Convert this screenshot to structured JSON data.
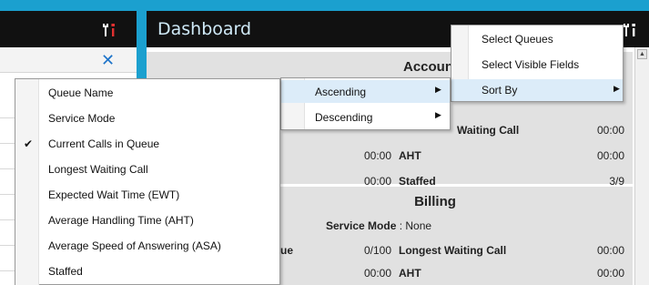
{
  "dashboard": {
    "title": "Dashboard"
  },
  "context_menu": {
    "items": [
      {
        "label": "Select Queues"
      },
      {
        "label": "Select Visible Fields"
      },
      {
        "label": "Sort By"
      }
    ]
  },
  "sort_menu": {
    "items": [
      {
        "label": "Ascending"
      },
      {
        "label": "Descending"
      }
    ]
  },
  "fields_menu": {
    "items": [
      {
        "label": "Queue Name",
        "checked": false
      },
      {
        "label": "Service Mode",
        "checked": false
      },
      {
        "label": "Current Calls in Queue",
        "checked": true
      },
      {
        "label": "Longest Waiting Call",
        "checked": false
      },
      {
        "label": "Expected Wait Time (EWT)",
        "checked": false
      },
      {
        "label": "Average Handling Time (AHT)",
        "checked": false
      },
      {
        "label": "Average Speed of Answering (ASA)",
        "checked": false
      },
      {
        "label": "Staffed",
        "checked": false
      }
    ],
    "check_glyph": "✔"
  },
  "cards": {
    "account": {
      "title": "Account",
      "waiting_call_label": "Waiting Call",
      "waiting_call_value": "00:00",
      "left_value_1": "00:00",
      "aht_label": "AHT",
      "aht_value": "00:00",
      "left_value_2": "00:00",
      "staffed_label": "Staffed",
      "staffed_value": "3/9"
    },
    "billing": {
      "title": "Billing",
      "service_mode_label": "Service Mode",
      "service_mode_sep": " : ",
      "service_mode_value": "None",
      "queue_label_fragment": "ue",
      "calls_value": "0/100",
      "longest_label": "Longest Waiting Call",
      "longest_value": "00:00",
      "left_value": "00:00",
      "aht_label": "AHT",
      "aht_value": "00:00"
    }
  },
  "colors": {
    "accent": "#1ba0cf",
    "header": "#111111",
    "highlight": "#dcecf9",
    "close": "#1c73c9"
  },
  "icons": {
    "tools": "tools-icon",
    "close": "close-icon",
    "submenu": "chevron-right-icon",
    "scroll_up": "scroll-up-arrow-icon"
  }
}
